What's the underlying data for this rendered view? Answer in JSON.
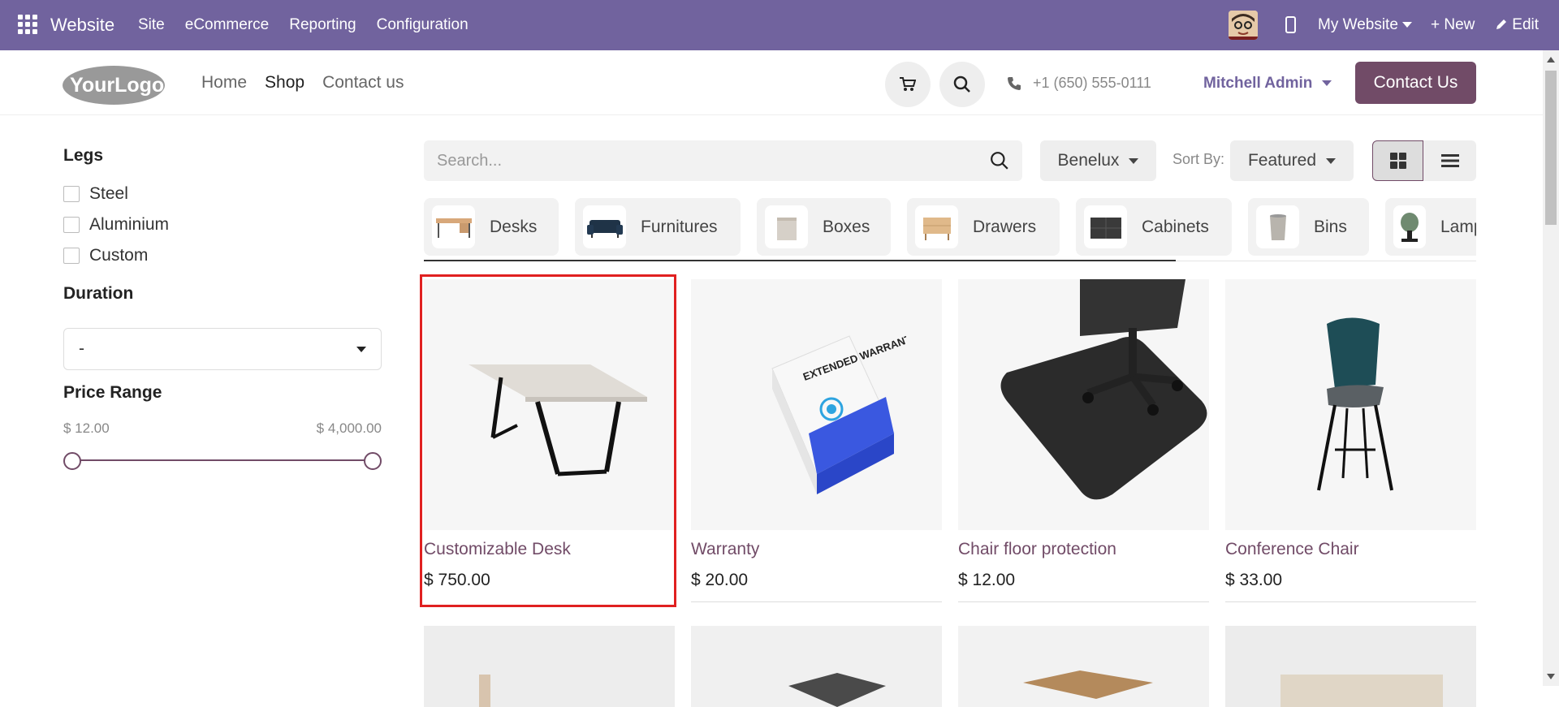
{
  "topbar": {
    "brand": "Website",
    "menu": [
      "Site",
      "eCommerce",
      "Reporting",
      "Configuration"
    ],
    "website_selector": "My Website",
    "new_label": "+ New",
    "edit_label": "Edit"
  },
  "header": {
    "logo_text": "YourLogo",
    "nav": [
      {
        "label": "Home"
      },
      {
        "label": "Shop"
      },
      {
        "label": "Contact us"
      }
    ],
    "phone": "+1 (650) 555-0111",
    "user": "Mitchell Admin",
    "contact_button": "Contact Us"
  },
  "sidebar": {
    "legs_title": "Legs",
    "legs_options": [
      "Steel",
      "Aluminium",
      "Custom"
    ],
    "duration_title": "Duration",
    "duration_value": "-",
    "price_title": "Price Range",
    "price_min": "$ 12.00",
    "price_max": "$ 4,000.00"
  },
  "toolbar": {
    "search_placeholder": "Search...",
    "pricelist": "Benelux",
    "sort_label": "Sort By:",
    "sort_value": "Featured"
  },
  "categories": [
    "Desks",
    "Furnitures",
    "Boxes",
    "Drawers",
    "Cabinets",
    "Bins",
    "Lamps"
  ],
  "products": [
    {
      "name": "Customizable Desk",
      "price": "$ 750.00"
    },
    {
      "name": "Warranty",
      "price": "$ 20.00"
    },
    {
      "name": "Chair floor protection",
      "price": "$ 12.00"
    },
    {
      "name": "Conference Chair",
      "price": "$ 33.00"
    }
  ],
  "warranty_box_text": "EXTENDED WARRANTY",
  "colors": {
    "topbar": "#71639e",
    "brand": "#714b67",
    "highlight": "#e02020"
  }
}
